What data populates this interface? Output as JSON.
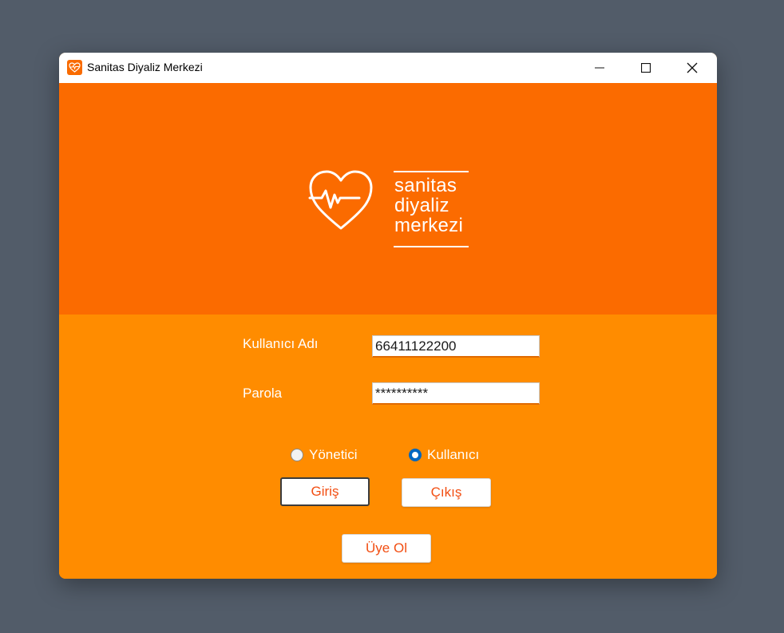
{
  "window": {
    "title": "Sanitas Diyaliz Merkezi",
    "app_icon": "heart-pulse-icon",
    "controls": [
      "minimize-icon",
      "maximize-icon",
      "close-icon"
    ]
  },
  "banner": {
    "background_color": "#fb6b00",
    "logo_icon": "heart-pulse-icon",
    "logo_lines": [
      "sanitas",
      "diyaliz",
      "merkezi"
    ]
  },
  "form": {
    "background_color": "#ff8c00",
    "username_label": "Kullanıcı Adı",
    "username_value": "66411122200",
    "password_label": "Parola",
    "password_value": "**********",
    "roles": [
      {
        "label": "Yönetici",
        "selected": false
      },
      {
        "label": "Kullanıcı",
        "selected": true
      }
    ],
    "login_button": "Giriş",
    "exit_button": "Çıkış",
    "register_button": "Üye Ol",
    "button_text_color": "#f24e12"
  }
}
